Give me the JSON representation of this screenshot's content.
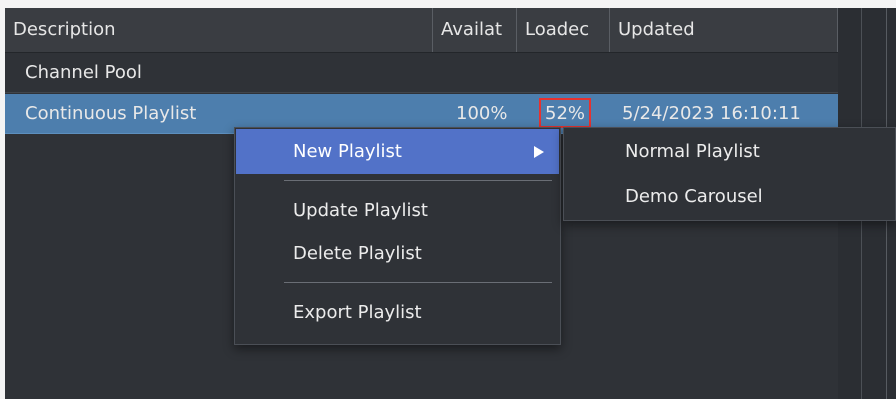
{
  "table": {
    "columns": [
      "Description",
      "Availat",
      "Loadec",
      "Updated"
    ],
    "rows": [
      {
        "description": "Channel Pool",
        "available": "",
        "loaded": "",
        "updated": ""
      },
      {
        "description": "Continuous Playlist",
        "available": "100%",
        "loaded": "52%",
        "updated": "5/24/2023 16:10:11"
      }
    ],
    "selected_row": "Continuous Playlist",
    "highlight_color": "#4d7ead",
    "outline_color": "#e6322f"
  },
  "context_menu": {
    "items": [
      {
        "label": "New Playlist",
        "has_submenu": true
      },
      {
        "label": "Update Playlist"
      },
      {
        "label": "Delete Playlist"
      },
      {
        "label": "Export Playlist"
      }
    ],
    "active_item": "New Playlist",
    "active_color": "#5272c8"
  },
  "submenu": {
    "items": [
      {
        "label": "Normal Playlist"
      },
      {
        "label": "Demo Carousel"
      }
    ]
  },
  "icons": {
    "submenu_arrow": "chevron-right-icon"
  }
}
